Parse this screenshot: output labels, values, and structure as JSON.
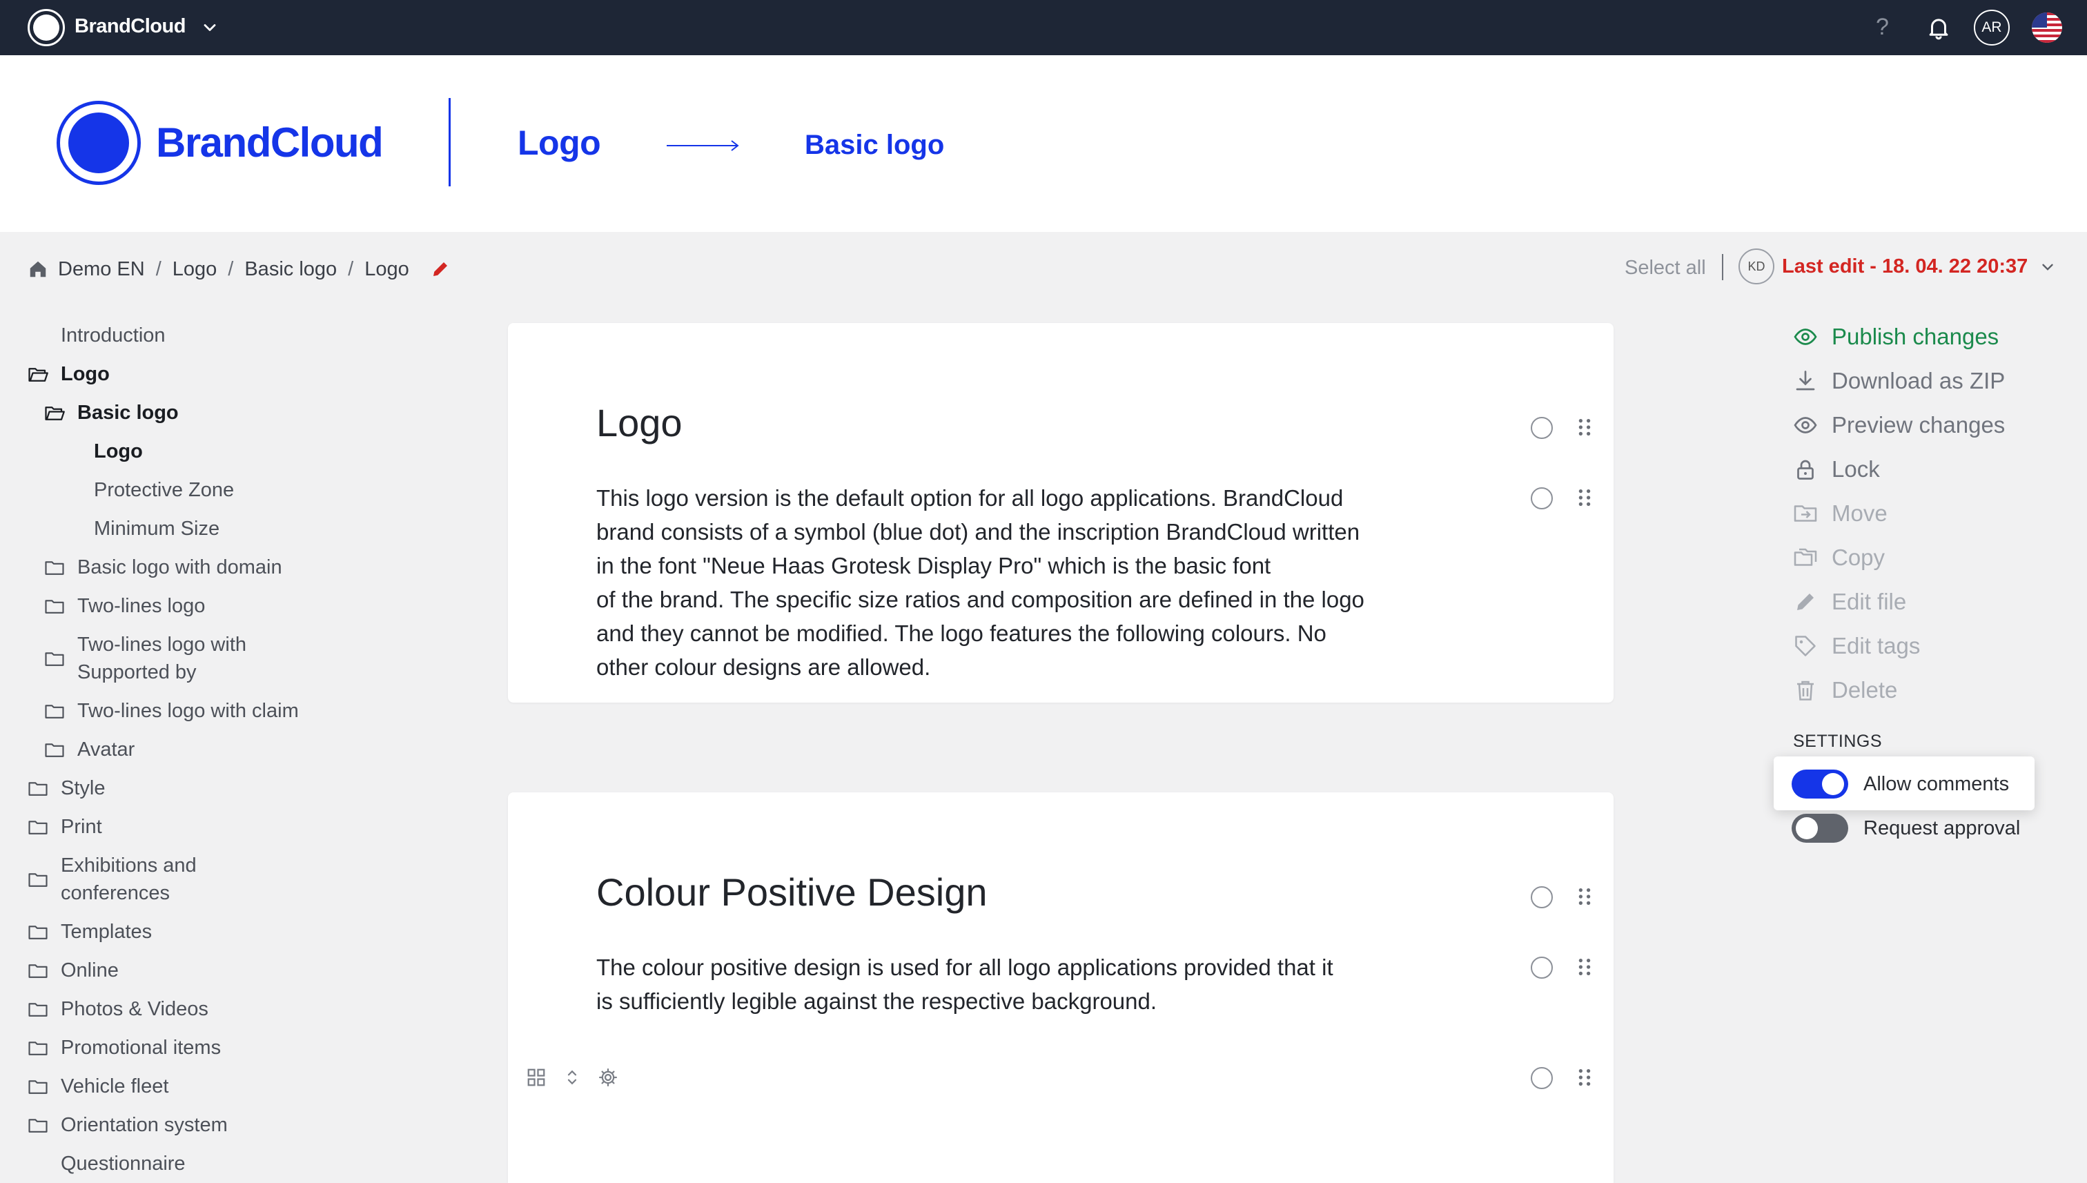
{
  "topbar": {
    "brand": "BrandCloud",
    "help": "?",
    "avatar_initials": "AR"
  },
  "header": {
    "brand_name": "BrandCloud",
    "section": "Logo",
    "subsection": "Basic logo"
  },
  "breadcrumb": [
    "Demo EN",
    "Logo",
    "Basic logo",
    "Logo"
  ],
  "toolbar": {
    "select_all": "Select all",
    "editor_initials": "KD",
    "last_edit": "Last edit - 18. 04. 22 20:37"
  },
  "sidebar": {
    "items": [
      {
        "label": "Introduction"
      },
      {
        "label": "Logo"
      },
      {
        "label": "Basic logo"
      },
      {
        "label": "Logo"
      },
      {
        "label": "Protective Zone"
      },
      {
        "label": "Minimum Size"
      },
      {
        "label": "Basic logo with domain"
      },
      {
        "label": "Two-lines logo"
      },
      {
        "label": "Two-lines logo with Supported by"
      },
      {
        "label": "Two-lines logo with claim"
      },
      {
        "label": "Avatar"
      },
      {
        "label": "Style"
      },
      {
        "label": "Print"
      },
      {
        "label": "Exhibitions and conferences"
      },
      {
        "label": "Templates"
      },
      {
        "label": "Online"
      },
      {
        "label": "Photos & Videos"
      },
      {
        "label": "Promotional items"
      },
      {
        "label": "Vehicle fleet"
      },
      {
        "label": "Orientation system"
      },
      {
        "label": "Questionnaire"
      }
    ]
  },
  "cards": [
    {
      "heading": "Logo",
      "lines": [
        "This logo version is the default option for all logo applications. BrandCloud",
        "brand consists of a symbol (blue dot) and the inscription BrandCloud written",
        "in the font \"Neue Haas Grotesk Display Pro\" which is the basic font",
        "of the brand. The specific size ratios and composition are defined in the logo",
        "and they cannot be modified. The logo features the following colours. No",
        "other colour designs are allowed."
      ]
    },
    {
      "heading": "Colour Positive Design",
      "lines": [
        "The colour positive design is used for all logo applications provided that it",
        "is sufficiently legible against the respective background."
      ]
    }
  ],
  "actions": {
    "publish": "Publish changes",
    "download": "Download as ZIP",
    "preview": "Preview changes",
    "lock": "Lock",
    "move": "Move",
    "copy": "Copy",
    "edit_file": "Edit file",
    "edit_tags": "Edit tags",
    "delete": "Delete"
  },
  "settings": {
    "heading": "SETTINGS",
    "allow_comments": {
      "label": "Allow comments",
      "on": true
    },
    "request_approval": {
      "label": "Request approval",
      "on": false
    }
  },
  "colors": {
    "brand_blue": "#1535e8",
    "topbar": "#1e2636",
    "publish_green": "#1b8a4c",
    "last_edit_red": "#d32622"
  }
}
